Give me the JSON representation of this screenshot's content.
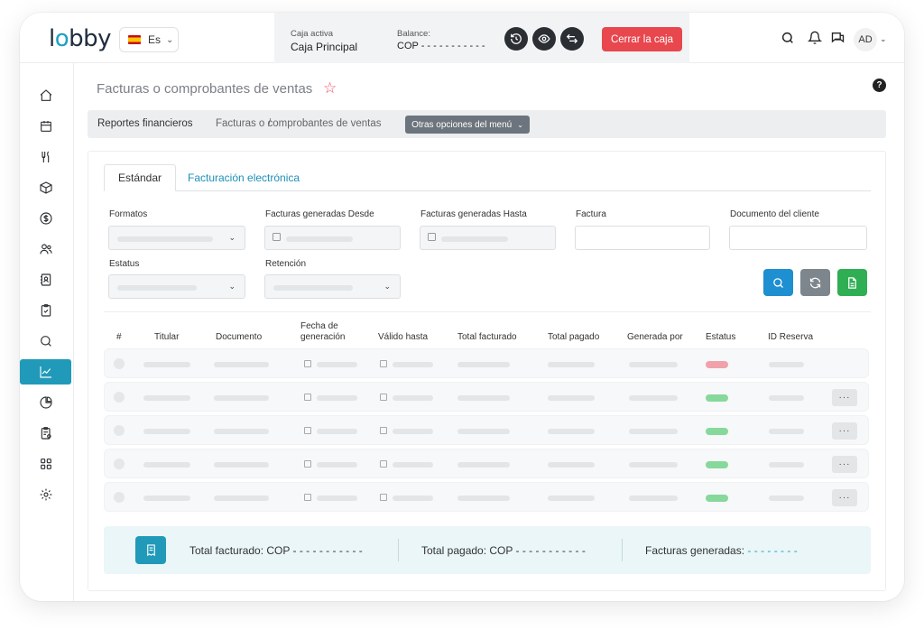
{
  "app": {
    "logo_text_a": "l",
    "logo_text_o": "o",
    "logo_text_b": "bby"
  },
  "language": {
    "selected": "Es"
  },
  "caja": {
    "active_label": "Caja activa",
    "active_value": "Caja Principal",
    "balance_label": "Balance:",
    "balance_value": "COP - - - - - - - - - - -",
    "close_button": "Cerrar la caja"
  },
  "user": {
    "initials": "AD"
  },
  "page": {
    "title": "Facturas o comprobantes de ventas",
    "breadcrumb": [
      "Reportes financieros",
      "/",
      "Facturas o comprobantes de ventas"
    ],
    "menu_button": "Otras opciones del menú"
  },
  "tabs": [
    {
      "label": "Estándar",
      "active": true
    },
    {
      "label": "Facturación electrónica",
      "active": false
    }
  ],
  "filters": {
    "formatos": "Formatos",
    "desde": "Facturas generadas Desde",
    "hasta": "Facturas generadas Hasta",
    "factura": "Factura",
    "documento": "Documento del cliente",
    "estatus": "Estatus",
    "retencion": "Retención"
  },
  "table": {
    "headers": {
      "num": "#",
      "titular": "Titular",
      "documento": "Documento",
      "fecha": "Fecha de\ngeneración",
      "valido": "Válido hasta",
      "total_facturado": "Total facturado",
      "total_pagado": "Total pagado",
      "generada": "Generada por",
      "estatus": "Estatus",
      "reserva": "ID Reserva"
    },
    "row_status_colors": [
      "#f0a1ac",
      "#86d99b",
      "#86d99b",
      "#86d99b",
      "#86d99b"
    ],
    "row_actions": "···"
  },
  "footer": {
    "total_facturado": "Total facturado: COP - - - - - - - - - - -",
    "total_pagado": "Total pagado: COP - - - - - - - - - - -",
    "facturas_generadas": "Facturas generadas:",
    "facturas_generadas_value": "- - - - - - - -"
  },
  "colors": {
    "accent": "#209ab8",
    "danger": "#e8474e",
    "search_button": "#1e8fd0",
    "refresh_button": "#7e868d",
    "export_button": "#2fae54"
  }
}
